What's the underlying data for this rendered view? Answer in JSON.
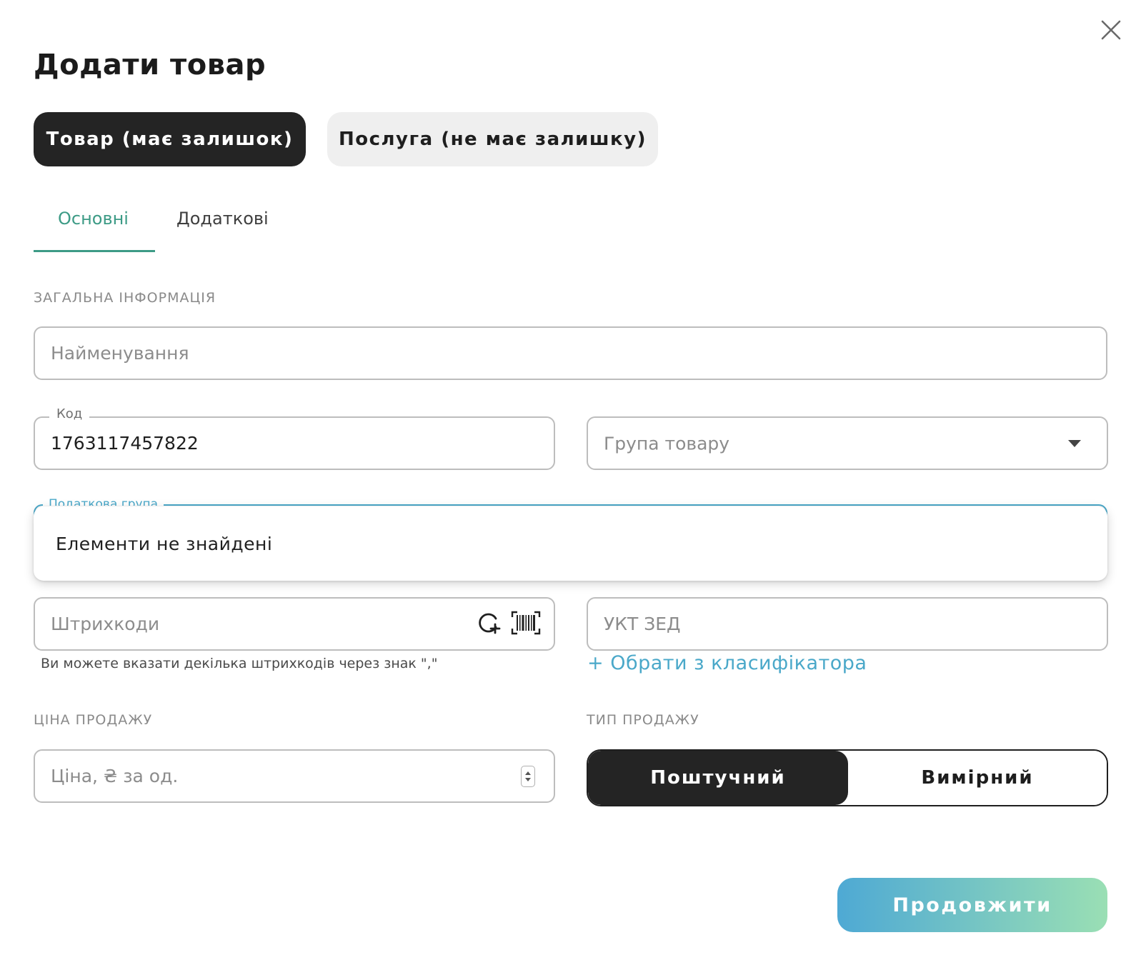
{
  "modal": {
    "title": "Додати товар",
    "close_icon": "close-icon"
  },
  "product_type": {
    "goods_label": "Товар (має залишок)",
    "service_label": "Послуга (не має залишку)",
    "selected": "goods"
  },
  "tabs": [
    {
      "label": "Основні",
      "active": true
    },
    {
      "label": "Додаткові",
      "active": false
    }
  ],
  "general_section": {
    "heading": "ЗАГАЛЬНА ІНФОРМАЦІЯ",
    "name_placeholder": "Найменування",
    "code_label": "Код",
    "code_value": "1763117457822",
    "group_placeholder": "Група товару",
    "tax_group_label": "Податкова група",
    "dropdown_empty_text": "Елементи не знайдені",
    "barcodes_placeholder": "Штрихкоди",
    "barcodes_hint": "Ви можете вказати декілька штрихкодів через знак \",\"",
    "uktzed_placeholder": "УКТ ЗЕД",
    "classifier_link": "+ Обрати з класифікатора"
  },
  "price_section": {
    "heading": "ЦІНА ПРОДАЖУ",
    "price_placeholder": "Ціна, ₴ за од."
  },
  "sale_type_section": {
    "heading": "ТИП ПРОДАЖУ",
    "piece_label": "Поштучний",
    "measured_label": "Вимірний",
    "selected": "piece"
  },
  "footer": {
    "continue_label": "Продовжити"
  },
  "colors": {
    "accent_green": "#3d9b86",
    "accent_blue": "#4aa8c9",
    "dark_button": "#242424",
    "gradient_start": "#4ea9d4",
    "gradient_end": "#9adfb4"
  }
}
